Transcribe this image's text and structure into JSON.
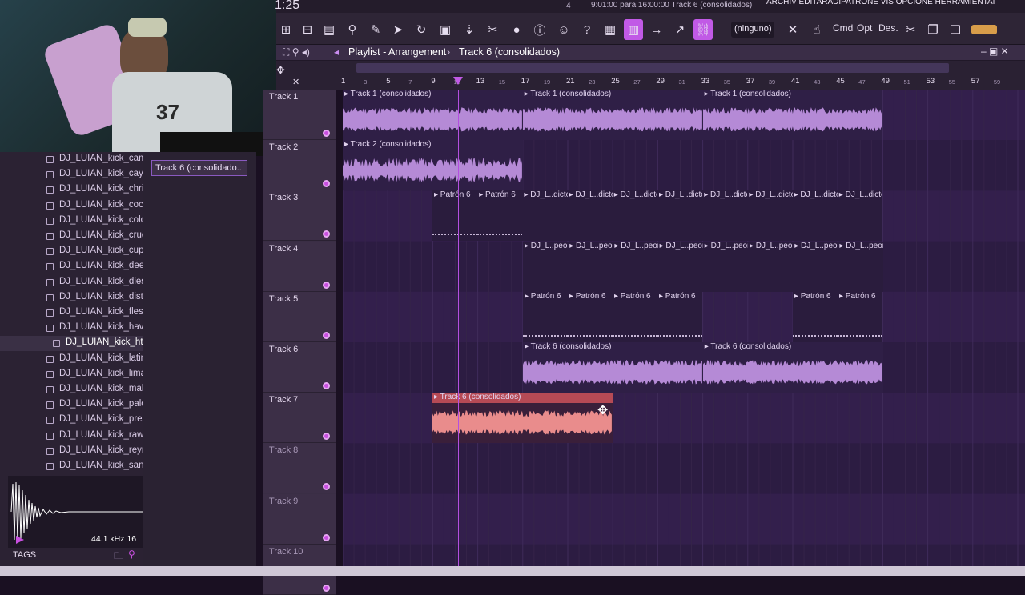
{
  "toolbar": {
    "time": "1:25",
    "counter": "4",
    "status_text": "9:01:00 para 16:00:00 Track 6 (consolidados)",
    "menu_text": "ARCHIV EDITARADIPATRONE VIS OPCIONE HERRAMIENTAI",
    "snap_label": "(ninguno)",
    "cmd_label": "Cmd",
    "opt_label": "Opt",
    "des_label": "Des."
  },
  "playlist": {
    "title": "Playlist - Arrangement",
    "current": "Track 6 (consolidados)"
  },
  "ruler": {
    "major": [
      "1",
      "5",
      "9",
      "13",
      "17",
      "21",
      "25",
      "29",
      "33",
      "37",
      "41",
      "45",
      "49",
      "53",
      "57"
    ],
    "minor": [
      "3",
      "7",
      "11",
      "15",
      "19",
      "23",
      "27",
      "31",
      "35",
      "39",
      "43",
      "47",
      "51",
      "55",
      "59"
    ]
  },
  "browser": {
    "items": [
      "DJ_LUIAN_kick_campeo",
      "DJ_LUIAN_kick_cayey",
      "DJ_LUIAN_kick_christina",
      "DJ_LUIAN_kick_coca",
      "DJ_LUIAN_kick_colon",
      "DJ_LUIAN_kick_cruda",
      "DJ_LUIAN_kick_cupey",
      "DJ_LUIAN_kick_deep",
      "DJ_LUIAN_kick_diesel",
      "DJ_LUIAN_kick_distancia",
      "DJ_LUIAN_kick_flesh",
      "DJ_LUIAN_kick_havannah",
      "DJ_LUIAN_kick_htm",
      "DJ_LUIAN_kick_latinos",
      "DJ_LUIAN_kick_lima",
      "DJ_LUIAN_kick_maldad",
      "DJ_LUIAN_kick_palomino",
      "DJ_LUIAN_kick_presion",
      "DJ_LUIAN_kick_raw",
      "DJ_LUIAN_kick_reym",
      "DJ_LUIAN_kick_sangre"
    ],
    "selected_index": 12,
    "sample_info": "44.1 kHz 16",
    "tags_label": "TAGS"
  },
  "picker": {
    "clip_label": "Track 6 (consolidado.."
  },
  "tracks": [
    "Track 1",
    "Track 2",
    "Track 3",
    "Track 4",
    "Track 5",
    "Track 6",
    "Track 7",
    "Track 8",
    "Track 9",
    "Track 10"
  ],
  "clips": {
    "t1": [
      "Track 1 (consolidados)",
      "Track 1 (consolidados)",
      "Track 1 (consolidados)"
    ],
    "t2": [
      "Track 2 (consolidados)"
    ],
    "t3": [
      "Patrón 6",
      "Patrón 6",
      "DJ_L..dicto",
      "DJ_L..dicto",
      "DJ_L..dicto",
      "DJ_L..dicto",
      "DJ_L..dicto",
      "DJ_L..dicto",
      "DJ_L..dicto",
      "DJ_L..dicto"
    ],
    "t4": [
      "DJ_L..peon",
      "DJ_L..peon",
      "DJ_L..peon",
      "DJ_L..peon",
      "DJ_L..peon",
      "DJ_L..peon",
      "DJ_L..peon",
      "DJ_L..peon"
    ],
    "t5": [
      "Patrón 6",
      "Patrón 6",
      "Patrón 6",
      "Patrón 6",
      "Patrón 6",
      "Patrón 6"
    ],
    "t6": [
      "Track 6 (consolidados)",
      "Track 6 (consolidados)"
    ],
    "t7": [
      "Track 6 (consolidados)"
    ]
  },
  "colors": {
    "accent": "#c84fe0",
    "clip_purple": "#b58ad6",
    "clip_red": "#e98c8c",
    "playhead": "#b44fe0"
  }
}
